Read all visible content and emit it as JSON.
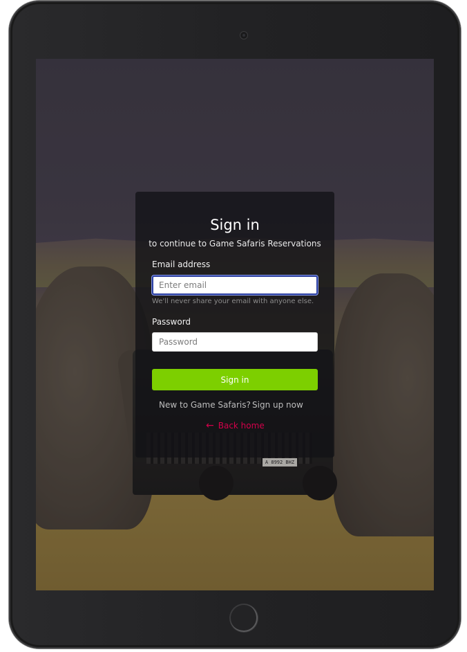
{
  "form": {
    "title": "Sign in",
    "subtitle": "to continue to Game Safaris Reservations",
    "email_label": "Email address",
    "email_placeholder": "Enter email",
    "email_value": "",
    "email_help": "We'll never share your email with anyone else.",
    "password_label": "Password",
    "password_placeholder": "Password",
    "password_value": "",
    "submit_label": "Sign in",
    "new_user_text": "New to Game Safaris?",
    "signup_link": "Sign up now",
    "back_home_link": "Back home",
    "back_icon": "arrow-left-icon"
  },
  "background": {
    "plate_text": "A 8992 BHZ"
  },
  "colors": {
    "button": "#7dcf00",
    "back_link": "#d4004a",
    "focus_border": "#2a3ea0"
  }
}
